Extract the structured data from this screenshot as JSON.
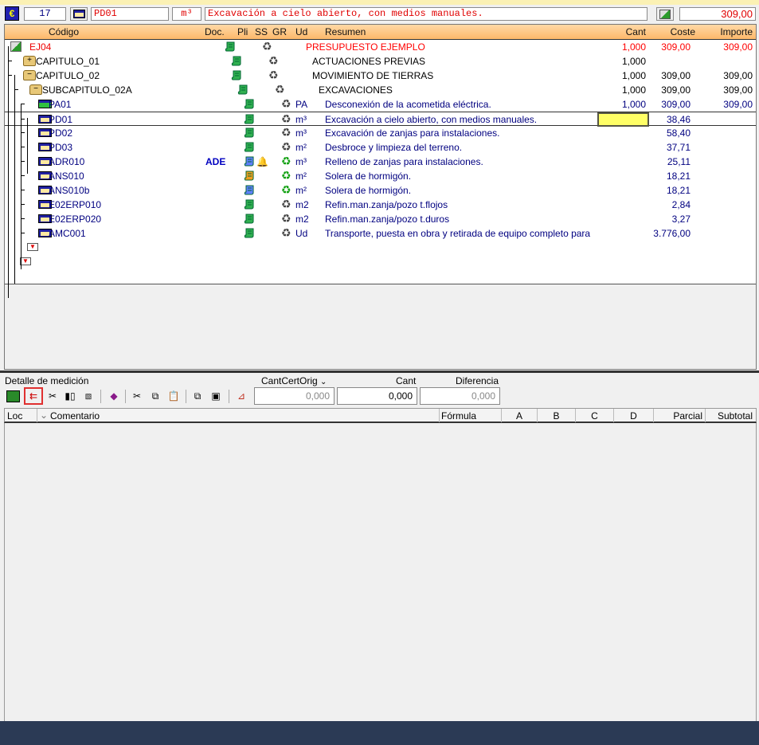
{
  "topbar": {
    "number": "17",
    "code": "PD01",
    "unit": "m³",
    "summary": "Excavación a cielo abierto, con medios manuales.",
    "total": "309,00"
  },
  "columns": {
    "code": "Código",
    "doc": "Doc.",
    "pli": "Pli",
    "ss": "SS",
    "gr": "GR",
    "ud": "Ud",
    "summary": "Resumen",
    "cant": "Cant",
    "coste": "Coste",
    "importe": "Importe"
  },
  "rows": [
    {
      "level": 0,
      "type": "root",
      "code": "EJ04",
      "ud": "",
      "summary": "PRESUPUESTO EJEMPLO",
      "cant": "1,000",
      "coste": "309,00",
      "importe": "309,00",
      "color": "#ff0000"
    },
    {
      "level": 1,
      "type": "folder-plus",
      "code": "CAPITULO_01",
      "ud": "",
      "summary": "ACTUACIONES PREVIAS",
      "cant": "1,000",
      "coste": "",
      "importe": "",
      "color": "#000000"
    },
    {
      "level": 1,
      "type": "folder-minus",
      "code": "CAPITULO_02",
      "ud": "",
      "summary": "MOVIMIENTO DE TIERRAS",
      "cant": "1,000",
      "coste": "309,00",
      "importe": "309,00",
      "color": "#000000"
    },
    {
      "level": 2,
      "type": "folder-minus",
      "code": "SUBCAPITULO_02A",
      "ud": "",
      "summary": "EXCAVACIONES",
      "cant": "1,000",
      "coste": "309,00",
      "importe": "309,00",
      "color": "#000000"
    },
    {
      "level": 3,
      "type": "green",
      "code": "PA01",
      "ud": "PA",
      "summary": "Desconexión de la acometida eléctrica.",
      "cant": "1,000",
      "coste": "309,00",
      "importe": "309,00",
      "color": "#000080"
    },
    {
      "level": 3,
      "type": "item",
      "code": "PD01",
      "ud": "m³",
      "summary": "Excavación a cielo abierto, con medios manuales.",
      "cant": "",
      "coste": "38,46",
      "importe": "",
      "color": "#000080",
      "selected": true
    },
    {
      "level": 3,
      "type": "item",
      "code": "PD02",
      "ud": "m³",
      "summary": "Excavación de zanjas para instalaciones.",
      "cant": "",
      "coste": "58,40",
      "importe": "",
      "color": "#000080"
    },
    {
      "level": 3,
      "type": "item",
      "code": "PD03",
      "ud": "m²",
      "summary": "Desbroce y limpieza del terreno.",
      "cant": "",
      "coste": "37,71",
      "importe": "",
      "color": "#000080"
    },
    {
      "level": 3,
      "type": "item",
      "code": "ADR010",
      "ud": "m³",
      "summary": "Relleno de zanjas para instalaciones.",
      "cant": "",
      "coste": "25,11",
      "importe": "",
      "color": "#000080",
      "doc": "ADE",
      "gr": "green",
      "extra": true,
      "pli": "special"
    },
    {
      "level": 3,
      "type": "item",
      "code": "ANS010",
      "ud": "m²",
      "summary": "Solera de hormigón.",
      "cant": "",
      "coste": "18,21",
      "importe": "",
      "color": "#000080",
      "gr": "green",
      "pli": "orange"
    },
    {
      "level": 3,
      "type": "item",
      "code": "ANS010b",
      "ud": "m²",
      "summary": "Solera de hormigón.",
      "cant": "",
      "coste": "18,21",
      "importe": "",
      "color": "#000080",
      "gr": "green",
      "pli": "special"
    },
    {
      "level": 3,
      "type": "item",
      "code": "E02ERP010",
      "ud": "m2",
      "summary": "Refin.man.zanja/pozo t.flojos",
      "cant": "",
      "coste": "2,84",
      "importe": "",
      "color": "#000080"
    },
    {
      "level": 3,
      "type": "item",
      "code": "E02ERP020",
      "ud": "m2",
      "summary": "Refin.man.zanja/pozo t.duros",
      "cant": "",
      "coste": "3,27",
      "importe": "",
      "color": "#000080"
    },
    {
      "level": 3,
      "type": "item",
      "code": "AMC001",
      "ud": "Ud",
      "summary": "Transporte, puesta en obra y retirada de equipo completo para",
      "cant": "",
      "coste": "3.776,00",
      "importe": "",
      "color": "#000080"
    }
  ],
  "detail": {
    "title": "Detalle de medición",
    "cantcert_label": "CantCertOrig",
    "cant_label": "Cant",
    "diff_label": "Diferencia",
    "cantcert_value": "0,000",
    "cant_value": "0,000",
    "diff_value": "0,000",
    "columns": {
      "loc": "Loc",
      "comment": "Comentario",
      "formula": "Fórmula",
      "a": "A",
      "b": "B",
      "c": "C",
      "d": "D",
      "parcial": "Parcial",
      "subtotal": "Subtotal"
    }
  },
  "icons": [
    "euro-tag-icon",
    "item-icon",
    "budget-icon",
    "add-line-icon",
    "book-icon",
    "cut-icon",
    "copy-icon",
    "paste-icon"
  ],
  "colors": {
    "header": "#fdb86a",
    "highlight": "#ffff66",
    "selected_tool": "#e03030"
  }
}
